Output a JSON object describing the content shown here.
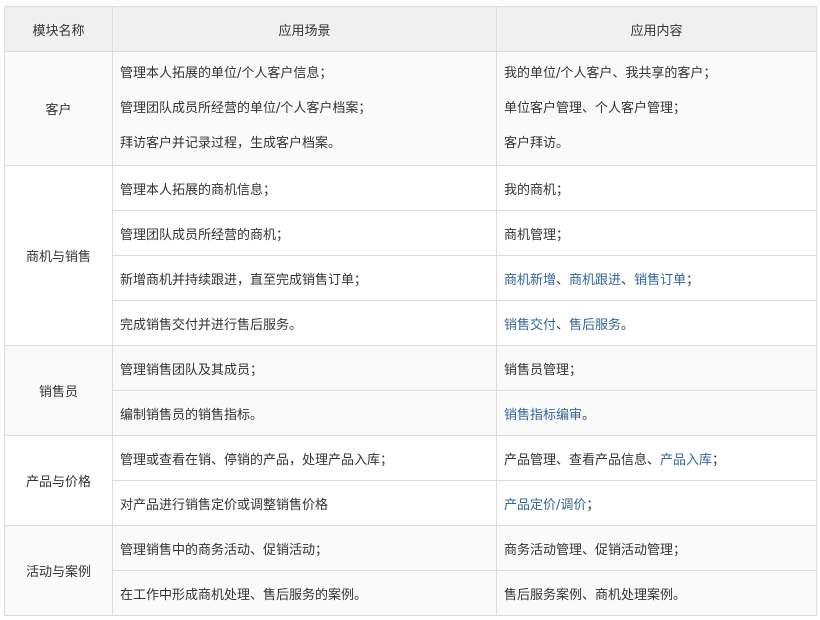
{
  "headers": [
    "模块名称",
    "应用场景",
    "应用内容"
  ],
  "colors": {
    "link": "#336699",
    "header_bg": "#f0f0f0",
    "border": "#dcdcdc"
  },
  "groups": [
    {
      "module": "客户",
      "rows": [
        {
          "scenes": [
            "管理本人拓展的单位/个人客户信息；",
            "管理团队成员所经营的单位/个人客户档案；",
            "拜访客户并记录过程，生成客户档案。"
          ],
          "contents": [
            [
              {
                "text": "我的单位/个人客户、我共享的客户；"
              }
            ],
            [
              {
                "text": "单位客户管理、个人客户管理；"
              }
            ],
            [
              {
                "text": "客户拜访。"
              }
            ]
          ]
        }
      ]
    },
    {
      "module": "商机与销售",
      "rows": [
        {
          "scenes": [
            "管理本人拓展的商机信息；"
          ],
          "contents": [
            [
              {
                "text": "我的商机；"
              }
            ]
          ]
        },
        {
          "scenes": [
            "管理团队成员所经营的商机；"
          ],
          "contents": [
            [
              {
                "text": "商机管理；"
              }
            ]
          ]
        },
        {
          "scenes": [
            "新增商机并持续跟进，直至完成销售订单；"
          ],
          "contents": [
            [
              {
                "text": "商机新增",
                "link": true
              },
              {
                "text": "、"
              },
              {
                "text": "商机跟进",
                "link": true
              },
              {
                "text": "、"
              },
              {
                "text": "销售订单",
                "link": true
              },
              {
                "text": "；"
              }
            ]
          ]
        },
        {
          "scenes": [
            "完成销售交付并进行售后服务。"
          ],
          "contents": [
            [
              {
                "text": "销售交付",
                "link": true
              },
              {
                "text": "、"
              },
              {
                "text": "售后服务",
                "link": true
              },
              {
                "text": "。"
              }
            ]
          ]
        }
      ]
    },
    {
      "module": "销售员",
      "rows": [
        {
          "scenes": [
            "管理销售团队及其成员；"
          ],
          "contents": [
            [
              {
                "text": "销售员管理；"
              }
            ]
          ]
        },
        {
          "scenes": [
            "编制销售员的销售指标。"
          ],
          "contents": [
            [
              {
                "text": "销售指标编审",
                "link": true
              },
              {
                "text": "。"
              }
            ]
          ]
        }
      ]
    },
    {
      "module": "产品与价格",
      "rows": [
        {
          "scenes": [
            "管理或查看在销、停销的产品，处理产品入库；"
          ],
          "contents": [
            [
              {
                "text": "产品管理、查看产品信息、"
              },
              {
                "text": "产品入库",
                "link": true
              },
              {
                "text": "；"
              }
            ]
          ]
        },
        {
          "scenes": [
            "对产品进行销售定价或调整销售价格"
          ],
          "contents": [
            [
              {
                "text": "产品定价/调价",
                "link": true
              },
              {
                "text": "；"
              }
            ]
          ]
        }
      ]
    },
    {
      "module": "活动与案例",
      "rows": [
        {
          "scenes": [
            "管理销售中的商务活动、促销活动；"
          ],
          "contents": [
            [
              {
                "text": "商务活动管理、促销活动管理；"
              }
            ]
          ]
        },
        {
          "scenes": [
            "在工作中形成商机处理、售后服务的案例。"
          ],
          "contents": [
            [
              {
                "text": "售后服务案例、商机处理案例。"
              }
            ]
          ]
        }
      ]
    }
  ]
}
